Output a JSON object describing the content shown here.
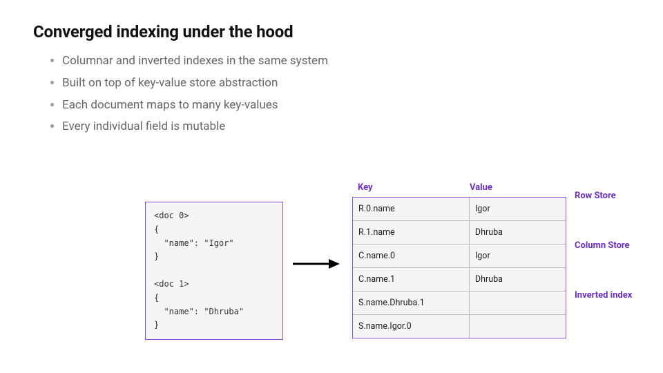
{
  "title": "Converged indexing under the hood",
  "bullets": [
    "Columnar and inverted indexes in the same system",
    "Built on top of key-value store abstraction",
    "Each document maps to many key-values",
    "Every individual field is mutable"
  ],
  "doc_text": "<doc 0>\n{\n  \"name\": \"Igor\"\n}\n\n<doc 1>\n{\n  \"name\": \"Dhruba\"\n}",
  "kv_header": {
    "key": "Key",
    "value": "Value"
  },
  "kv_rows": [
    {
      "key": "R.0.name",
      "value": "Igor"
    },
    {
      "key": "R.1.name",
      "value": "Dhruba"
    },
    {
      "key": "C.name.0",
      "value": "Igor"
    },
    {
      "key": "C.name.1",
      "value": "Dhruba"
    },
    {
      "key": "S.name.Dhruba.1",
      "value": ""
    },
    {
      "key": "S.name.Igor.0",
      "value": ""
    }
  ],
  "side_labels": {
    "row_store": "Row Store",
    "column_store": "Column Store",
    "inverted_index": "Inverted index"
  },
  "colors": {
    "accent": "#6a2fc2",
    "border": "#8a4fd8"
  }
}
